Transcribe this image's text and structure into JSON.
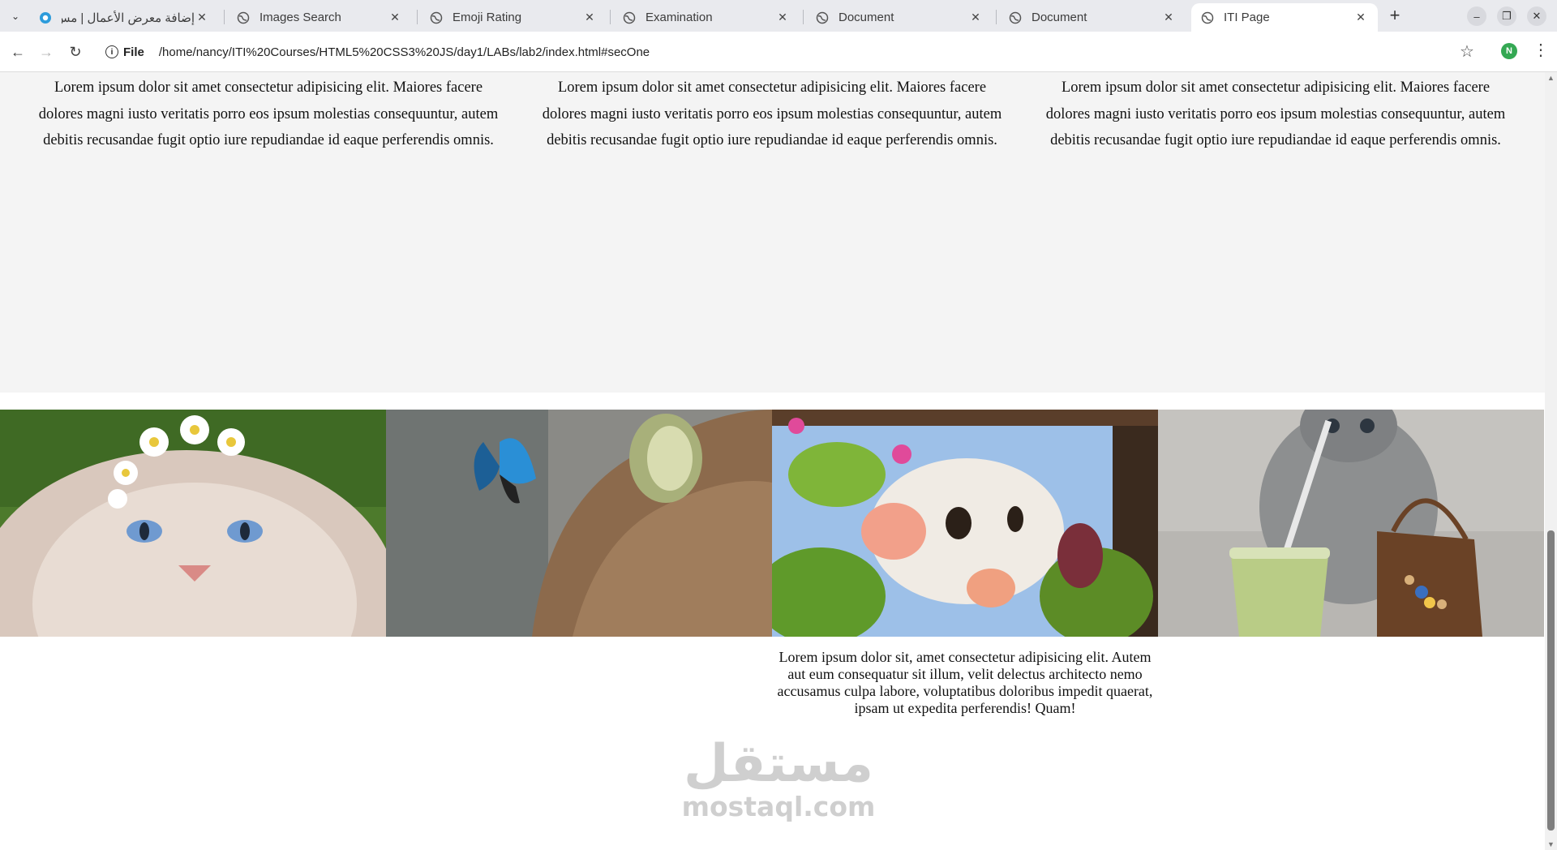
{
  "browser": {
    "tabs": [
      {
        "title": "إضافة معرض الأعمال | مس...",
        "icon": "mostaql-icon",
        "active": false
      },
      {
        "title": "Images Search",
        "icon": "globe-icon",
        "active": false
      },
      {
        "title": "Emoji Rating",
        "icon": "globe-icon",
        "active": false
      },
      {
        "title": "Examination",
        "icon": "globe-icon",
        "active": false
      },
      {
        "title": "Document",
        "icon": "globe-icon",
        "active": false
      },
      {
        "title": "Document",
        "icon": "globe-icon",
        "active": false
      },
      {
        "title": "ITI Page",
        "icon": "globe-icon",
        "active": true
      }
    ],
    "address": {
      "scheme_label": "File",
      "url": "/home/nancy/ITI%20Courses/HTML5%20CSS3%20JS/day1/LABs/lab2/index.html#secOne"
    },
    "profile_initial": "N",
    "accent": "#34a853"
  },
  "page": {
    "columns": [
      "Lorem ipsum dolor sit amet consectetur adipisicing elit. Maiores facere dolores magni iusto veritatis porro eos ipsum molestias consequuntur, autem debitis recusandae fugit optio iure repudiandae id eaque perferendis omnis.",
      "Lorem ipsum dolor sit amet consectetur adipisicing elit. Maiores facere dolores magni iusto veritatis porro eos ipsum molestias consequuntur, autem debitis recusandae fugit optio iure repudiandae id eaque perferendis omnis.",
      "Lorem ipsum dolor sit amet consectetur adipisicing elit. Maiores facere dolores magni iusto veritatis porro eos ipsum molestias consequuntur, autem debitis recusandae fugit optio iure repudiandae id eaque perferendis omnis."
    ],
    "gallery": [
      {
        "name": "cat-flower-crown-photo"
      },
      {
        "name": "cat-butterfly-photo"
      },
      {
        "name": "kitten-in-leaves-photo"
      },
      {
        "name": "kitten-with-drink-photo"
      }
    ],
    "caption": "Lorem ipsum dolor sit, amet consectetur adipisicing elit. Autem aut eum consequatur sit illum, velit delectus architecto nemo accusamus culpa labore, voluptatibus doloribus impedit quaerat, ipsam ut expedita perferendis! Quam!",
    "watermark": {
      "arabic": "مستقل",
      "latin": "mostaql.com"
    }
  }
}
